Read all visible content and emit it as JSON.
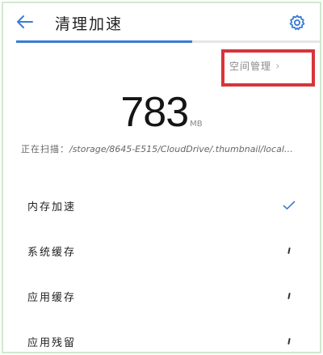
{
  "header": {
    "title": "清理加速",
    "back_icon": "arrow-left-icon",
    "settings_icon": "gear-icon"
  },
  "scan_progress": 0.58,
  "space_management": {
    "label": "空间管理",
    "chevron_icon": "chevron-right-icon"
  },
  "junk": {
    "value": "783",
    "unit": "MB"
  },
  "scan": {
    "label": "正在扫描：",
    "path": "/storage/8645-E515/CloudDrive/.thumbnail/local…"
  },
  "items": [
    {
      "label": "内存加速",
      "status": "done",
      "status_icon": "checkmark-icon"
    },
    {
      "label": "系统缓存",
      "status": "scanning",
      "status_icon": "spinner-icon"
    },
    {
      "label": "应用缓存",
      "status": "scanning",
      "status_icon": "spinner-icon"
    },
    {
      "label": "应用残留",
      "status": "scanning",
      "status_icon": "spinner-icon"
    }
  ],
  "colors": {
    "accent": "#3a7bd5",
    "highlight_border": "#d8343a",
    "frame_border": "#cfe9cf"
  }
}
